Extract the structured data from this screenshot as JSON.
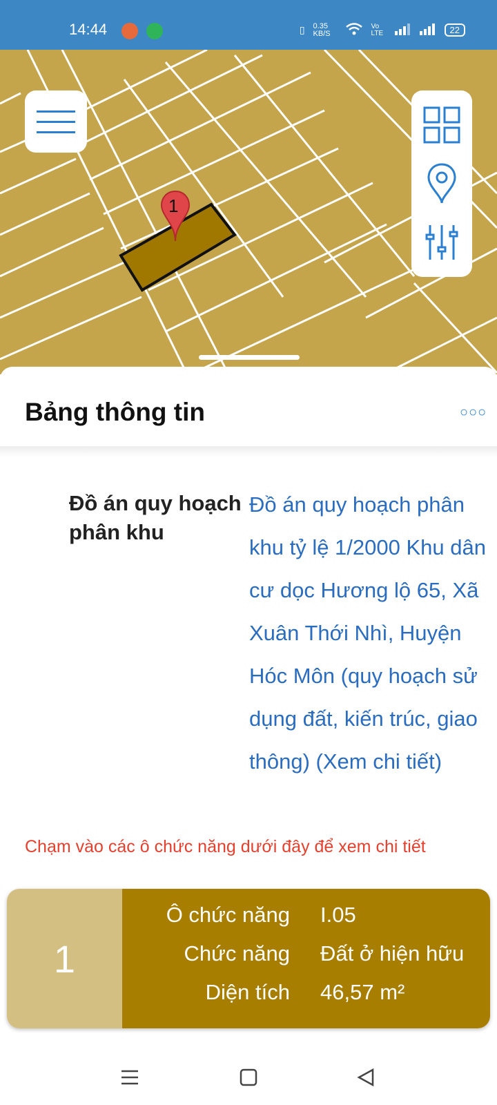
{
  "status_bar": {
    "time": "14:44",
    "network_speed": "0.35 KB/S",
    "network_type": "Vo LTE",
    "battery": "22"
  },
  "map": {
    "marker_label": "1",
    "colors": {
      "land": "#c4a54b",
      "parcel": "#a07800",
      "lines": "#ffffff"
    }
  },
  "map_tools": {
    "menu_icon": "hamburger-icon",
    "layers_icon": "grid-icon",
    "location_icon": "location-pin-icon",
    "filter_icon": "sliders-icon"
  },
  "info_panel": {
    "title": "Bảng thông tin",
    "more_icon": "more-dots-icon",
    "plan_label": "Đồ án quy hoạch phân khu",
    "plan_value": "Đồ án quy hoạch phân khu tỷ lệ 1/2000 Khu dân cư dọc Hương lộ 65, Xã Xuân Thới Nhì, Huyện Hóc Môn (quy hoạch sử dụng đất, kiến trúc, giao thông) (Xem chi tiết)",
    "hint": "Chạm vào các ô chức năng dưới đây để xem chi tiết"
  },
  "function_card": {
    "number": "1",
    "rows": [
      {
        "key": "Ô chức năng",
        "value": "I.05"
      },
      {
        "key": "Chức năng",
        "value": "Đất ở hiện hữu"
      },
      {
        "key": "Diện tích",
        "value": "46,57 m²"
      }
    ],
    "colors": {
      "number_bg": "#d3bf82",
      "info_bg": "#a87e00"
    }
  },
  "nav_bar": {
    "recent_icon": "recent-apps-icon",
    "home_icon": "home-icon",
    "back_icon": "back-icon"
  }
}
